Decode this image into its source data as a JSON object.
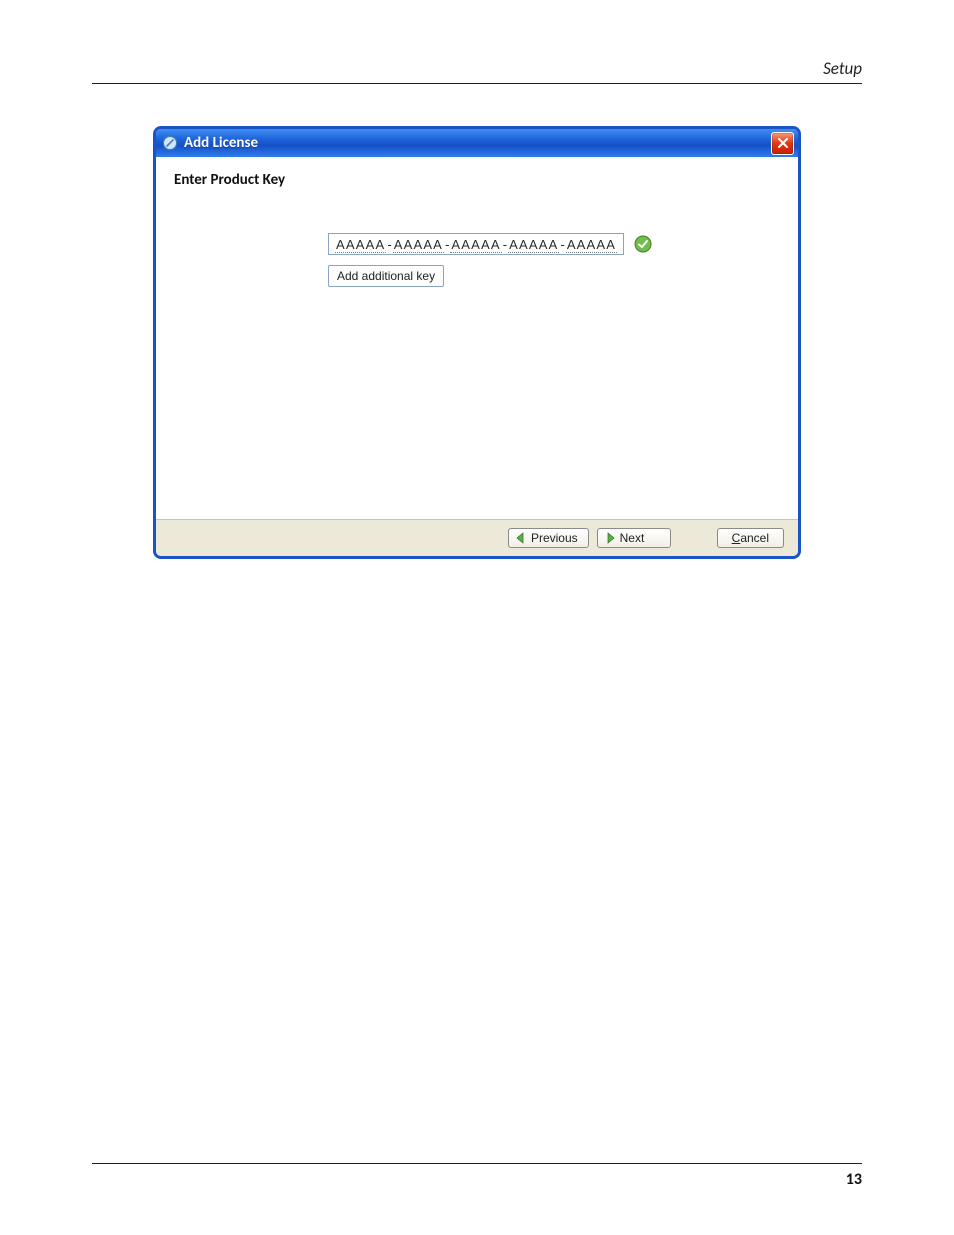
{
  "page": {
    "header_label": "Setup",
    "page_number": "13"
  },
  "dialog": {
    "title": "Add License",
    "subtitle": "Enter Product Key",
    "key_groups": [
      "AAAAA",
      "AAAAA",
      "AAAAA",
      "AAAAA",
      "AAAAA"
    ],
    "add_key_label": "Add additional key",
    "buttons": {
      "previous": "Previous",
      "next": "Next",
      "cancel_u": "C",
      "cancel_rest": "ancel"
    }
  },
  "icons": {
    "app": "block-icon",
    "close": "close-icon",
    "success": "check-circle-icon",
    "prev_arrow": "arrow-left-icon",
    "next_arrow": "arrow-right-icon"
  }
}
